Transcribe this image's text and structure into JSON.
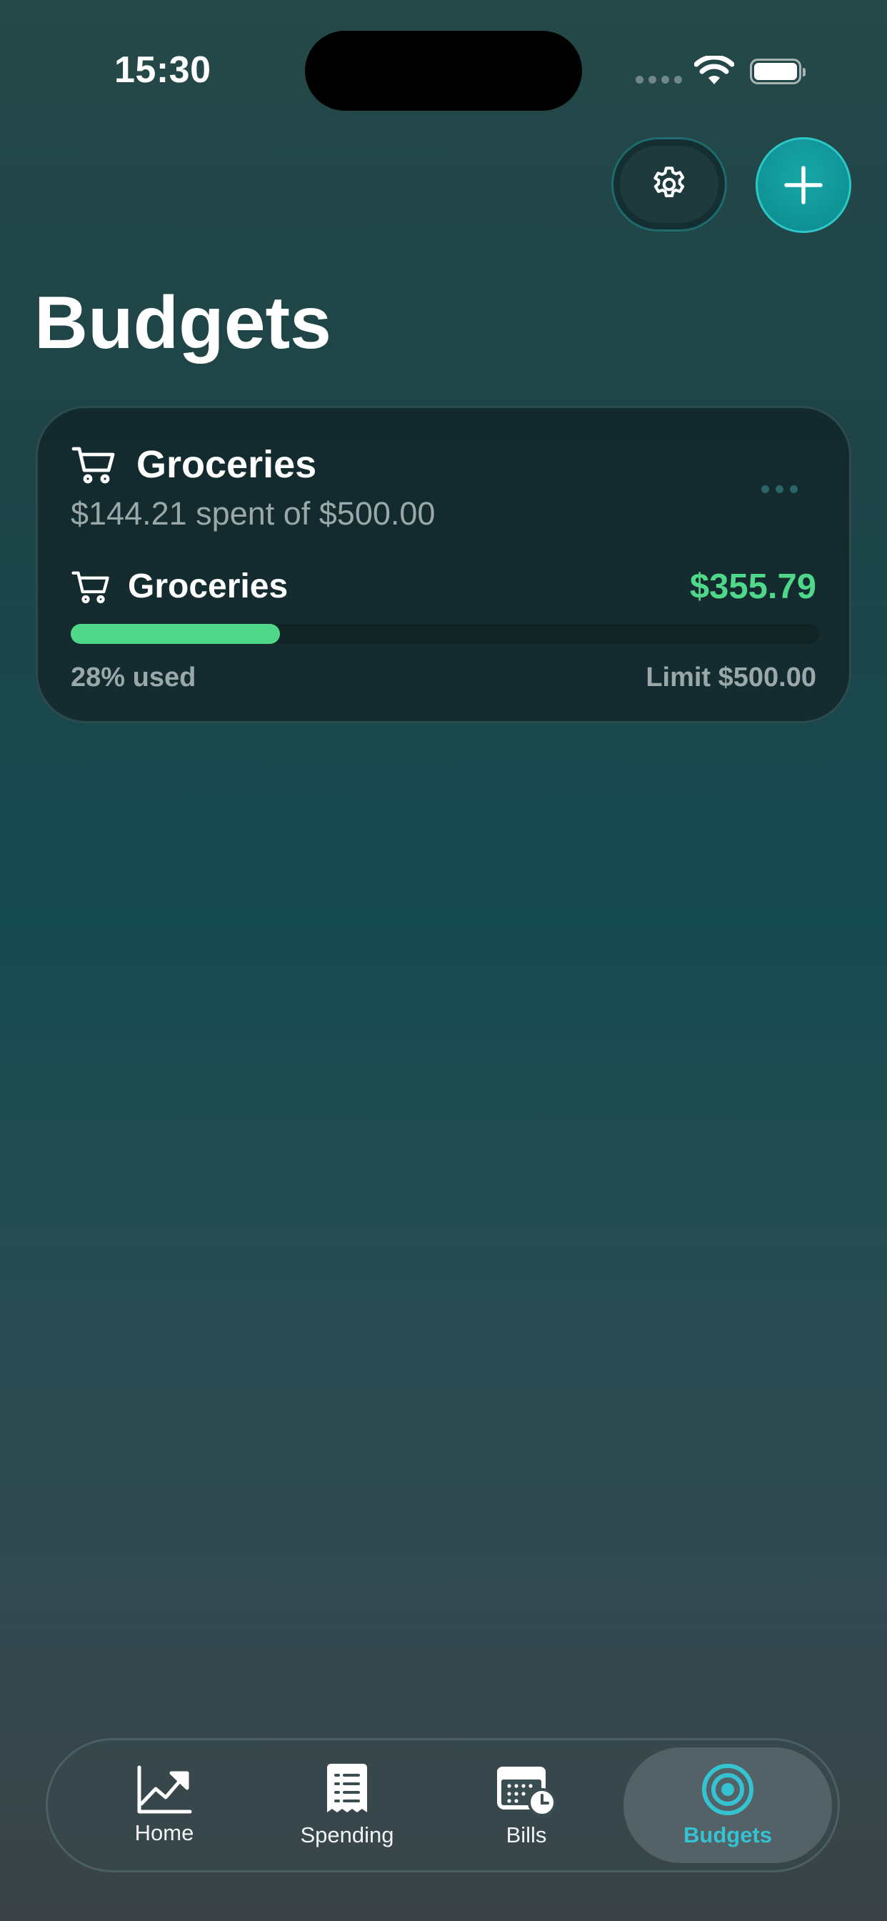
{
  "status_bar": {
    "time": "15:30"
  },
  "header": {
    "title": "Budgets"
  },
  "budget": {
    "title": "Groceries",
    "subtitle": "$144.21 spent of $500.00",
    "category": "Groceries",
    "remaining": "$355.79",
    "used_label": "28% used",
    "used_fraction": 0.28,
    "limit_label": "Limit $500.00"
  },
  "tabs": [
    {
      "label": "Home",
      "icon": "chart-line-icon"
    },
    {
      "label": "Spending",
      "icon": "receipt-icon"
    },
    {
      "label": "Bills",
      "icon": "calendar-clock-icon"
    },
    {
      "label": "Budgets",
      "icon": "target-icon",
      "active": true
    }
  ],
  "colors": {
    "accent": "#34c3d1",
    "progress": "#4fd88a",
    "add_button": "#0f9395"
  }
}
